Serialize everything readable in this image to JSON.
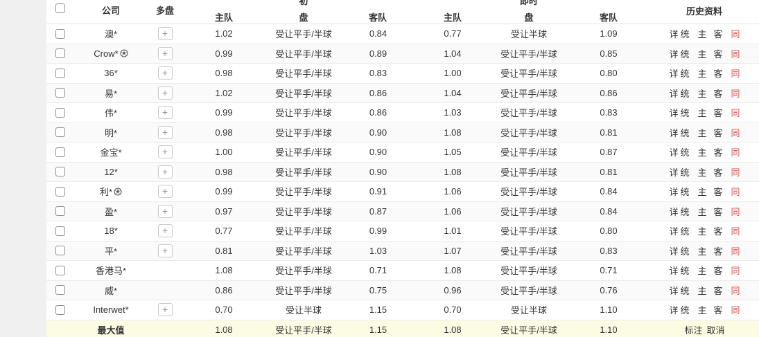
{
  "table": {
    "header": {
      "company": "公司",
      "multi": "多盘",
      "group_initial": "初",
      "group_live": "即时",
      "sub_home": "主队",
      "sub_pan": "盘",
      "sub_away": "客队",
      "history": "历史资料"
    },
    "history_links": [
      "详",
      "统",
      "主",
      "客",
      "同"
    ],
    "rows": [
      {
        "company": "澳*",
        "ball": false,
        "multi": true,
        "init_home": "1.02",
        "init_pan": "受让平手/半球",
        "init_away": "0.84",
        "live_home": "0.77",
        "live_pan": "受让半球",
        "live_away": "1.09"
      },
      {
        "company": "Crow*",
        "ball": true,
        "multi": true,
        "init_home": "0.99",
        "init_pan": "受让平手/半球",
        "init_away": "0.89",
        "live_home": "1.04",
        "live_pan": "受让平手/半球",
        "live_away": "0.85"
      },
      {
        "company": "36*",
        "ball": false,
        "multi": true,
        "init_home": "0.98",
        "init_pan": "受让平手/半球",
        "init_away": "0.83",
        "live_home": "1.00",
        "live_pan": "受让平手/半球",
        "live_away": "0.80"
      },
      {
        "company": "易*",
        "ball": false,
        "multi": true,
        "init_home": "1.02",
        "init_pan": "受让平手/半球",
        "init_away": "0.86",
        "live_home": "1.04",
        "live_pan": "受让平手/半球",
        "live_away": "0.86"
      },
      {
        "company": "伟*",
        "ball": false,
        "multi": true,
        "init_home": "0.99",
        "init_pan": "受让平手/半球",
        "init_away": "0.86",
        "live_home": "1.03",
        "live_pan": "受让平手/半球",
        "live_away": "0.83"
      },
      {
        "company": "明*",
        "ball": false,
        "multi": true,
        "init_home": "0.98",
        "init_pan": "受让平手/半球",
        "init_away": "0.90",
        "live_home": "1.08",
        "live_pan": "受让平手/半球",
        "live_away": "0.81"
      },
      {
        "company": "金宝*",
        "ball": false,
        "multi": true,
        "init_home": "1.00",
        "init_pan": "受让平手/半球",
        "init_away": "0.90",
        "live_home": "1.05",
        "live_pan": "受让平手/半球",
        "live_away": "0.87"
      },
      {
        "company": "12*",
        "ball": false,
        "multi": true,
        "init_home": "0.98",
        "init_pan": "受让平手/半球",
        "init_away": "0.90",
        "live_home": "1.08",
        "live_pan": "受让平手/半球",
        "live_away": "0.81"
      },
      {
        "company": "利*",
        "ball": true,
        "multi": true,
        "init_home": "0.99",
        "init_pan": "受让平手/半球",
        "init_away": "0.91",
        "live_home": "1.06",
        "live_pan": "受让平手/半球",
        "live_away": "0.84"
      },
      {
        "company": "盈*",
        "ball": false,
        "multi": true,
        "init_home": "0.97",
        "init_pan": "受让平手/半球",
        "init_away": "0.87",
        "live_home": "1.06",
        "live_pan": "受让平手/半球",
        "live_away": "0.84"
      },
      {
        "company": "18*",
        "ball": false,
        "multi": true,
        "init_home": "0.77",
        "init_pan": "受让平手/半球",
        "init_away": "0.99",
        "live_home": "1.01",
        "live_pan": "受让平手/半球",
        "live_away": "0.80"
      },
      {
        "company": "平*",
        "ball": false,
        "multi": true,
        "init_home": "0.81",
        "init_pan": "受让平手/半球",
        "init_away": "1.03",
        "live_home": "1.07",
        "live_pan": "受让平手/半球",
        "live_away": "0.83"
      },
      {
        "company": "香港马*",
        "ball": false,
        "multi": false,
        "init_home": "1.08",
        "init_pan": "受让平手/半球",
        "init_away": "0.71",
        "live_home": "1.08",
        "live_pan": "受让平手/半球",
        "live_away": "0.71"
      },
      {
        "company": "威*",
        "ball": false,
        "multi": false,
        "init_home": "0.86",
        "init_pan": "受让平手/半球",
        "init_away": "0.75",
        "live_home": "0.96",
        "live_pan": "受让平手/半球",
        "live_away": "0.76"
      },
      {
        "company": "Interwet*",
        "ball": false,
        "multi": true,
        "init_home": "0.70",
        "init_pan": "受让半球",
        "init_away": "1.15",
        "live_home": "0.70",
        "live_pan": "受让半球",
        "live_away": "1.10"
      }
    ],
    "footer": {
      "label": "最大值",
      "init_home": "1.08",
      "init_pan": "受让平手/半球",
      "init_away": "1.15",
      "live_home": "1.08",
      "live_pan": "受让平手/半球",
      "live_away": "1.10",
      "links": [
        "标注",
        "取消"
      ]
    }
  },
  "colors": {
    "page_bg": "#f0f0f0",
    "alt_row_bg": "#fafafa",
    "footer_bg": "#fcfce4",
    "accent_red": "#d9534f",
    "text": "#333333"
  }
}
